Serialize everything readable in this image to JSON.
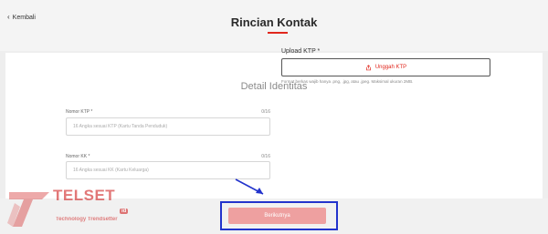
{
  "header": {
    "back_label": "Kembali",
    "title": "Rincian Kontak"
  },
  "form": {
    "section_title": "Detail Identitas",
    "ktp": {
      "label": "Nomor KTP *",
      "counter": "0/16",
      "placeholder": "16 Angka sesuai KTP (Kartu Tanda Penduduk)"
    },
    "kk": {
      "label": "Nomor KK *",
      "counter": "0/16",
      "placeholder": "16 Angka sesuai KK (Kartu Keluarga)"
    },
    "upload": {
      "label": "Upload KTP *",
      "button_label": "Unggah KTP",
      "note": "Format berkas wajib hanya .png, .jpg, atau .jpeg. Maksimal ukuran 2MB."
    }
  },
  "footer": {
    "next_label": "Berikutnya"
  },
  "watermark": {
    "brand": "TELSET",
    "suffix": "id",
    "tagline": "Technology Trendsetter"
  },
  "colors": {
    "accent": "#e0261c",
    "disabled_button": "#eea0a0",
    "annotation_blue": "#2233cc"
  }
}
